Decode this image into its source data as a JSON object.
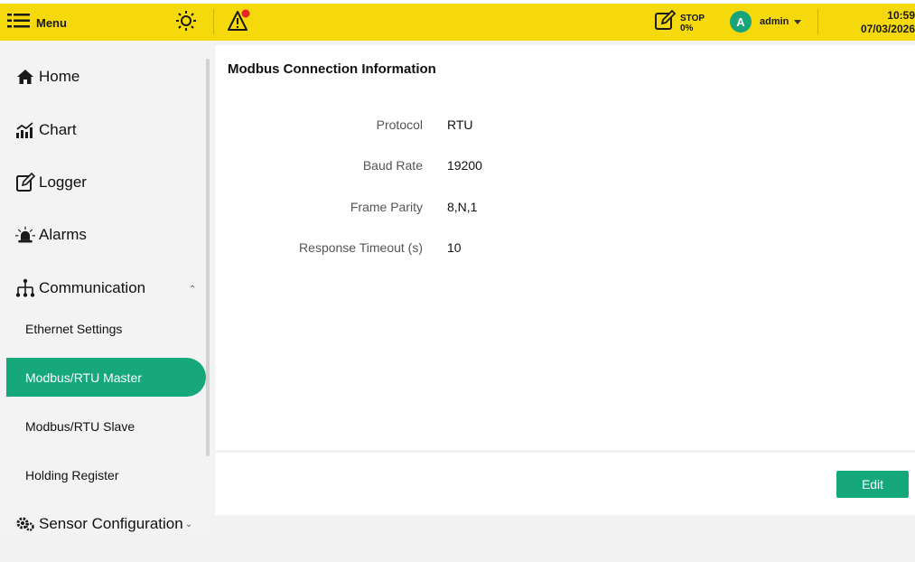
{
  "header": {
    "menu_label": "Menu",
    "menu_icon": "hamburger-icon",
    "brightness_icon": "sun-icon",
    "alert_icon": "warning-icon",
    "recording": {
      "icon": "edit-record-icon",
      "status": "STOP",
      "percent": "0%"
    },
    "user": {
      "initial": "A",
      "name": "admin"
    },
    "time": "10:59",
    "date": "07/03/2026",
    "accent_color": "#f5d90a",
    "alert_dot_color": "#e8242a"
  },
  "sidebar": {
    "items": [
      {
        "label": "Home",
        "icon": "home-icon"
      },
      {
        "label": "Chart",
        "icon": "chart-icon"
      },
      {
        "label": "Logger",
        "icon": "logger-icon"
      },
      {
        "label": "Alarms",
        "icon": "alarm-icon"
      },
      {
        "label": "Communication",
        "icon": "network-icon"
      }
    ],
    "communication_sub": [
      "Ethernet Settings",
      "Modbus/RTU Master",
      "Modbus/RTU Slave",
      "Holding Register"
    ],
    "active_sub": "Modbus/RTU Master",
    "sensor_label": "Sensor Configuration",
    "active_color": "#16a77b"
  },
  "main": {
    "title": "Modbus Connection Information",
    "fields": [
      {
        "label": "Protocol",
        "value": "RTU"
      },
      {
        "label": "Baud Rate",
        "value": "19200"
      },
      {
        "label": "Frame Parity",
        "value": "8,N,1"
      },
      {
        "label": "Response Timeout (s)",
        "value": "10"
      }
    ],
    "edit_label": "Edit"
  }
}
